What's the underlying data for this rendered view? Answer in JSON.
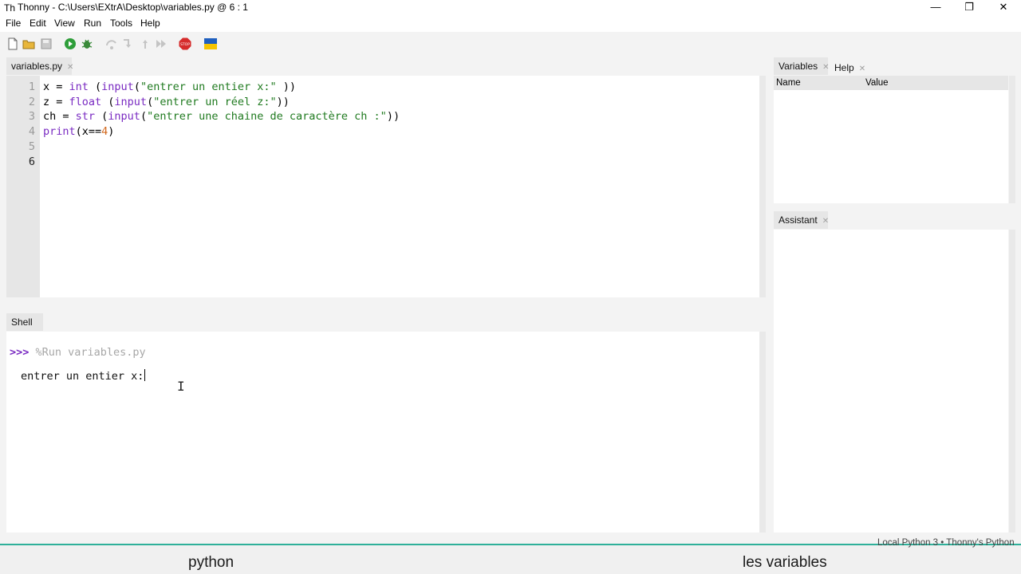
{
  "window": {
    "app_icon": "Th",
    "title": "Thonny  -  C:\\Users\\EXtrA\\Desktop\\variables.py  @  6 : 1",
    "minimize": "—",
    "maximize": "❐",
    "close": "✕"
  },
  "menu": [
    "File",
    "Edit",
    "View",
    "Run",
    "Tools",
    "Help"
  ],
  "toolbar": {
    "icons": [
      "new-file-icon",
      "open-folder-icon",
      "save-icon",
      "run-icon",
      "debug-icon",
      "step-over-icon",
      "step-into-icon",
      "step-out-icon",
      "resume-icon",
      "stop-icon",
      "ukraine-flag-icon"
    ],
    "stop_label": "STOP"
  },
  "editor": {
    "tab_label": "variables.py",
    "tab_close": "✕",
    "line_numbers": [
      "1",
      "2",
      "3",
      "4",
      "5",
      "6"
    ],
    "lines": [
      [
        "x = ",
        "int",
        " (",
        "input",
        "(",
        "\"entrer un entier x:\" ",
        "))"
      ],
      [
        "z = ",
        "float",
        " (",
        "input",
        "(",
        "\"entrer un réel z:\"",
        "))"
      ],
      [
        "ch = ",
        "str",
        " (",
        "input",
        "(",
        "\"entrer une chaine de caractère ch :\"",
        "))"
      ],
      [
        "print",
        "(x==",
        "4",
        ")"
      ]
    ]
  },
  "shell": {
    "tab_label": "Shell",
    "prompt": ">>>",
    "command": " %Run variables.py",
    "output": "entrer un entier x:",
    "cursor": "I"
  },
  "variables": {
    "tab_label": "Variables",
    "help_tab_label": "Help",
    "tab_close": "✕",
    "col_name": "Name",
    "col_value": "Value"
  },
  "assistant": {
    "tab_label": "Assistant",
    "tab_close": "✕"
  },
  "status": "Local Python 3  •  Thonny's Python",
  "captions": {
    "left": "python",
    "right": "les variables"
  },
  "colors": {
    "keyword": "#7a2bc2",
    "string": "#1f7a1f",
    "number": "#d2691e",
    "accent_line": "#2fb09a"
  }
}
